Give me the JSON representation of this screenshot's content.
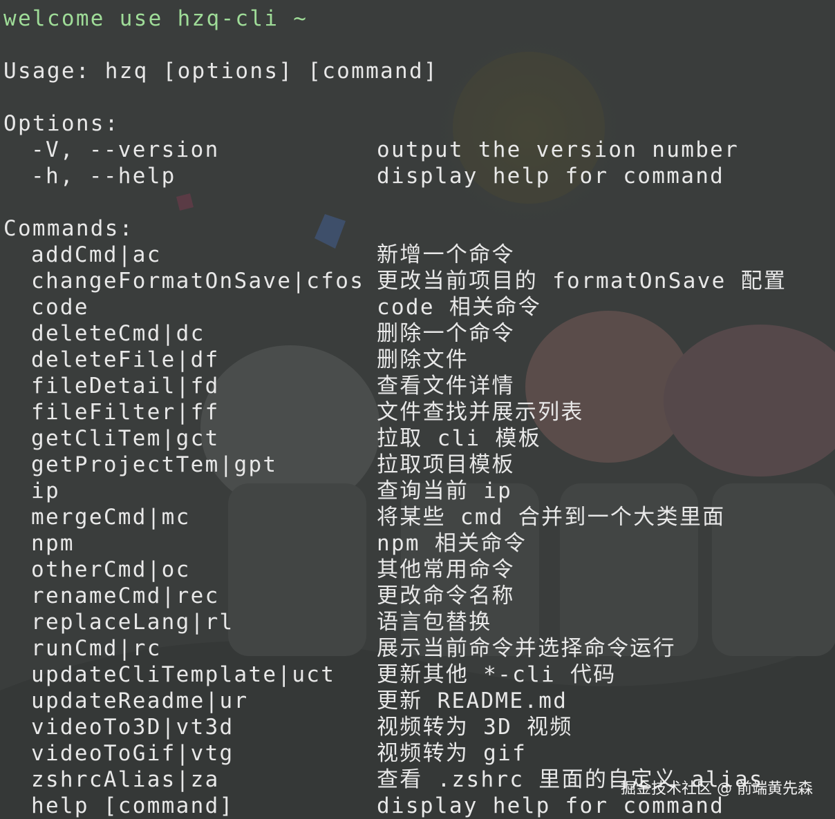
{
  "welcome": "welcome use hzq-cli ~",
  "usage": "Usage: hzq [options] [command]",
  "options_header": "Options:",
  "options": [
    {
      "flag": "-V, --version",
      "desc": "output the version number"
    },
    {
      "flag": "-h, --help",
      "desc": "display help for command"
    }
  ],
  "commands_header": "Commands:",
  "commands": [
    {
      "name": "addCmd|ac",
      "desc": "新增一个命令"
    },
    {
      "name": "changeFormatOnSave|cfos",
      "desc": "更改当前项目的 formatOnSave 配置"
    },
    {
      "name": "code",
      "desc": "code 相关命令"
    },
    {
      "name": "deleteCmd|dc",
      "desc": "删除一个命令"
    },
    {
      "name": "deleteFile|df",
      "desc": "删除文件"
    },
    {
      "name": "fileDetail|fd",
      "desc": "查看文件详情"
    },
    {
      "name": "fileFilter|ff",
      "desc": "文件查找并展示列表"
    },
    {
      "name": "getCliTem|gct",
      "desc": "拉取 cli 模板"
    },
    {
      "name": "getProjectTem|gpt",
      "desc": "拉取项目模板"
    },
    {
      "name": "ip",
      "desc": "查询当前 ip"
    },
    {
      "name": "mergeCmd|mc",
      "desc": "将某些 cmd 合并到一个大类里面"
    },
    {
      "name": "npm",
      "desc": "npm 相关命令"
    },
    {
      "name": "otherCmd|oc",
      "desc": "其他常用命令"
    },
    {
      "name": "renameCmd|rec",
      "desc": "更改命令名称"
    },
    {
      "name": "replaceLang|rl",
      "desc": "语言包替换"
    },
    {
      "name": "runCmd|rc",
      "desc": "展示当前命令并选择命令运行"
    },
    {
      "name": "updateCliTemplate|uct",
      "desc": "更新其他 *-cli 代码"
    },
    {
      "name": "updateReadme|ur",
      "desc": "更新 README.md"
    },
    {
      "name": "videoTo3D|vt3d",
      "desc": "视频转为 3D 视频"
    },
    {
      "name": "videoToGif|vtg",
      "desc": "视频转为 gif"
    },
    {
      "name": "zshrcAlias|za",
      "desc": "查看 .zshrc 里面的自定义 alias"
    },
    {
      "name": "help [command]",
      "desc": "display help for command"
    }
  ],
  "watermark": "掘金技术社区 @ 前端黄先森",
  "colors": {
    "background": "#3a3d3c",
    "text": "#e8e8e8",
    "welcome": "#9fdc98"
  }
}
